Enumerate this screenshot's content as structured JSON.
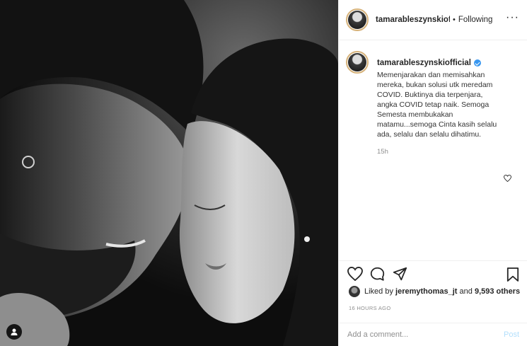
{
  "post": {
    "image_alt": "",
    "tag_icon": "user-tag-icon"
  },
  "header": {
    "username": "tamarableszynskiofficial",
    "dot": "•",
    "follow_status": "Following",
    "more_icon": "more-icon"
  },
  "caption": {
    "username": "tamarableszynskiofficial",
    "verified": true,
    "text": "Memenjarakan dan memisahkan mereka, bukan solusi utk meredam COVID. Buktinya dia terpenjara, angka COVID tetap naik. Semoga Semesta membukakan matamu...semoga Cinta kasih selalu ada, selalu dan selalu dihatimu.",
    "age": "15h"
  },
  "actions": {
    "like_icon": "heart-icon",
    "comment_icon": "comment-icon",
    "share_icon": "share-icon",
    "save_icon": "bookmark-icon"
  },
  "likes": {
    "prefix": "Liked by",
    "user": "jeremythomas_jt",
    "and": "and",
    "count": "9,593 others"
  },
  "timestamp": "16 HOURS AGO",
  "add_comment": {
    "placeholder": "Add a comment...",
    "post_label": "Post"
  },
  "colors": {
    "verified": "#3897f0",
    "post_button": "#b2dffc",
    "muted": "#8e8e8e"
  }
}
